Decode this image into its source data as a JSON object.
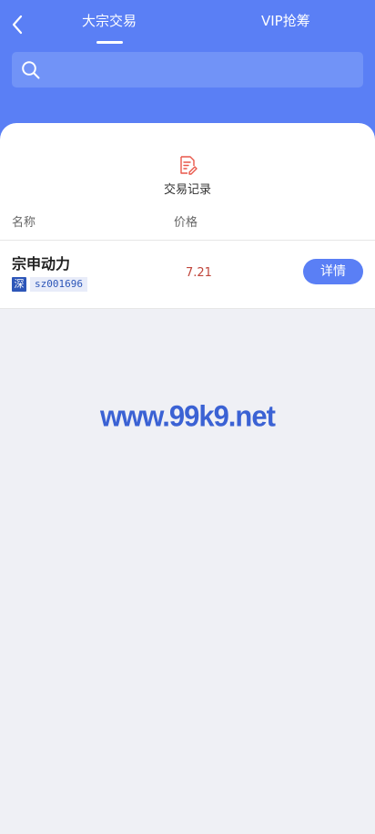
{
  "header": {
    "tabs": [
      {
        "label": "大宗交易",
        "active": true
      },
      {
        "label": "VIP抢筹",
        "active": false
      }
    ],
    "back_icon": "chevron-left-icon"
  },
  "search": {
    "placeholder": "",
    "value": "",
    "icon": "search-icon"
  },
  "records": {
    "label": "交易记录",
    "icon": "edit-document-icon",
    "icon_color": "#e9574a"
  },
  "table": {
    "columns": [
      "名称",
      "价格"
    ],
    "rows": [
      {
        "name": "宗申动力",
        "market": "深",
        "code": "sz001696",
        "price": "7.21",
        "action": "详情"
      }
    ]
  },
  "watermark": "www.99k9.net",
  "colors": {
    "primary": "#5a7ff5",
    "price": "#c0453b",
    "badge": "#2d56b8",
    "background": "#eff0f5"
  }
}
